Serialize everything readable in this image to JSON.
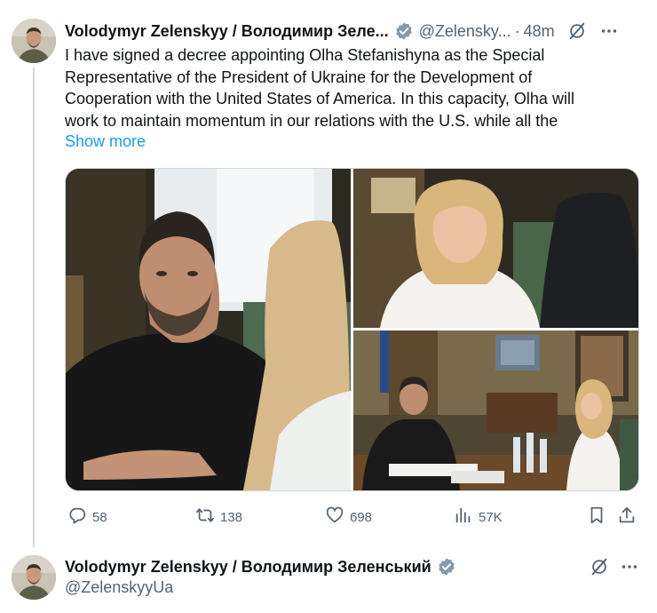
{
  "tweet": {
    "author_name": "Volodymyr Zelenskyy / Володимир Зеле...",
    "handle": "@Zelensky...",
    "separator": "·",
    "time": "48m",
    "text_lines": [
      "I have signed a decree appointing Olha Stefanishyna as the Special",
      "Representative of the President of Ukraine for the Development of",
      "Cooperation with the United States of America. In this capacity, Olha will",
      "work to maintain momentum in our relations with the U.S. while all the"
    ],
    "show_more": "Show more",
    "photos": [
      {
        "name": "zelenskyy-portrait-photo"
      },
      {
        "name": "stefanishyna-portrait-photo"
      },
      {
        "name": "meeting-office-photo"
      }
    ],
    "stats": {
      "replies": "58",
      "reposts": "138",
      "likes": "698",
      "views": "57K"
    },
    "icons": {
      "verified": "verified-badge-icon",
      "grok": "grok-icon",
      "more": "more-options-icon",
      "reply": "reply-icon",
      "repost": "repost-icon",
      "like": "heart-icon",
      "views": "views-icon",
      "bookmark": "bookmark-icon",
      "share": "share-icon"
    },
    "accent_color": "#1d9bf0",
    "verified_color": "#829aab"
  },
  "reply_tweet": {
    "author_name": "Volodymyr Zelenskyy / Володимир Зеленський",
    "handle": "@ZelenskyyUa"
  }
}
